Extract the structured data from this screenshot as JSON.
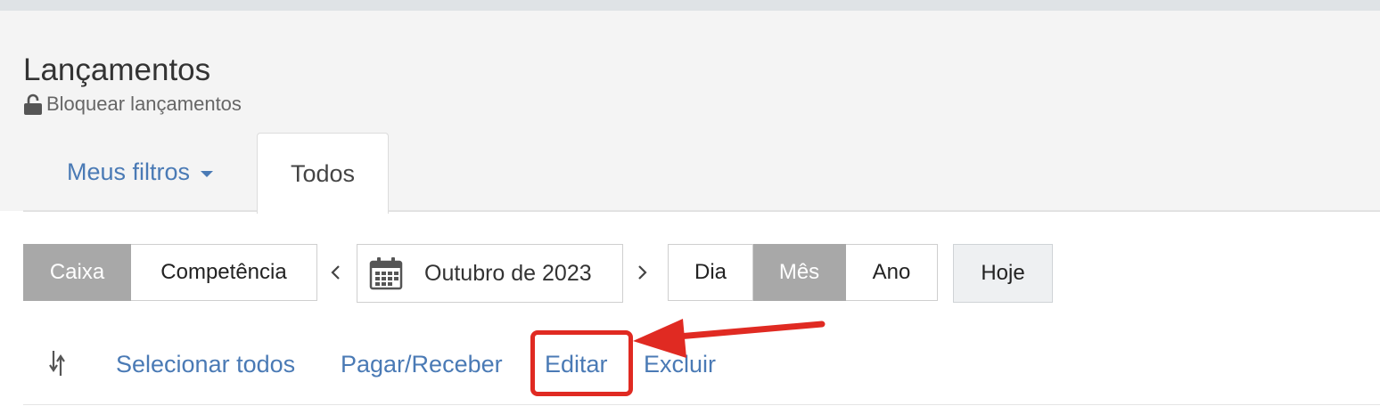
{
  "header": {
    "title": "Lançamentos",
    "lock_label": "Bloquear lançamentos",
    "lock_icon": "unlock-icon"
  },
  "tabs": {
    "filters_label": "Meus filtros",
    "all_label": "Todos",
    "active": "Todos"
  },
  "regime": {
    "options": [
      "Caixa",
      "Competência"
    ],
    "selected": "Caixa"
  },
  "period_nav": {
    "prev": "‹",
    "next": "›",
    "date_label": "Outubro de 2023",
    "calendar_icon": "calendar-icon"
  },
  "granularity": {
    "options": [
      "Dia",
      "Mês",
      "Ano"
    ],
    "selected": "Mês"
  },
  "today_label": "Hoje",
  "actions": {
    "sort_icon": "sort-arrows-icon",
    "select_all": "Selecionar todos",
    "pay_receive": "Pagar/Receber",
    "edit": "Editar",
    "delete": "Excluir"
  },
  "colors": {
    "link": "#4a7ab5",
    "active_segment": "#a8a8a8",
    "highlight": "#e02a22",
    "header_bg": "#f4f4f4"
  }
}
